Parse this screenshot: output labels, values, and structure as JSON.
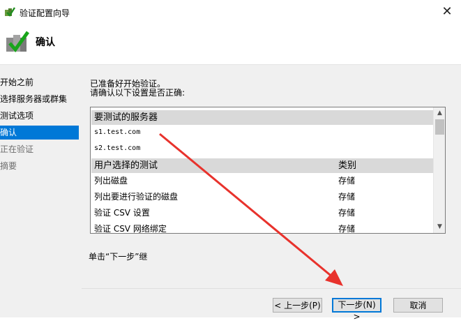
{
  "window": {
    "title": "验证配置向导",
    "close_glyph": "✕"
  },
  "header": {
    "title": "确认"
  },
  "sidebar": {
    "items": [
      {
        "label": "开始之前"
      },
      {
        "label": "选择服务器或群集"
      },
      {
        "label": "测试选项"
      },
      {
        "label": "确认"
      },
      {
        "label": "正在验证"
      },
      {
        "label": "摘要"
      }
    ]
  },
  "main": {
    "status_line1": "已准备好开始验证。",
    "status_line2": "请确认以下设置是否正确:",
    "servers_header": "要测试的服务器",
    "servers": [
      "s1.test.com",
      "s2.test.com"
    ],
    "tests_header": "用户选择的测试",
    "category_header": "类别",
    "tests": [
      {
        "name": "列出磁盘",
        "category": "存储"
      },
      {
        "name": "列出要进行验证的磁盘",
        "category": "存储"
      },
      {
        "name": "验证 CSV 设置",
        "category": "存储"
      },
      {
        "name": "验证 CSV 网络绑定",
        "category": "存储"
      }
    ],
    "hint": "单击“下一步”继"
  },
  "buttons": {
    "back": "< 上一步(P)",
    "next": "下一步(N) >",
    "cancel": "取消"
  },
  "colors": {
    "accent": "#0078d7",
    "annotation_arrow": "#e8322c"
  }
}
